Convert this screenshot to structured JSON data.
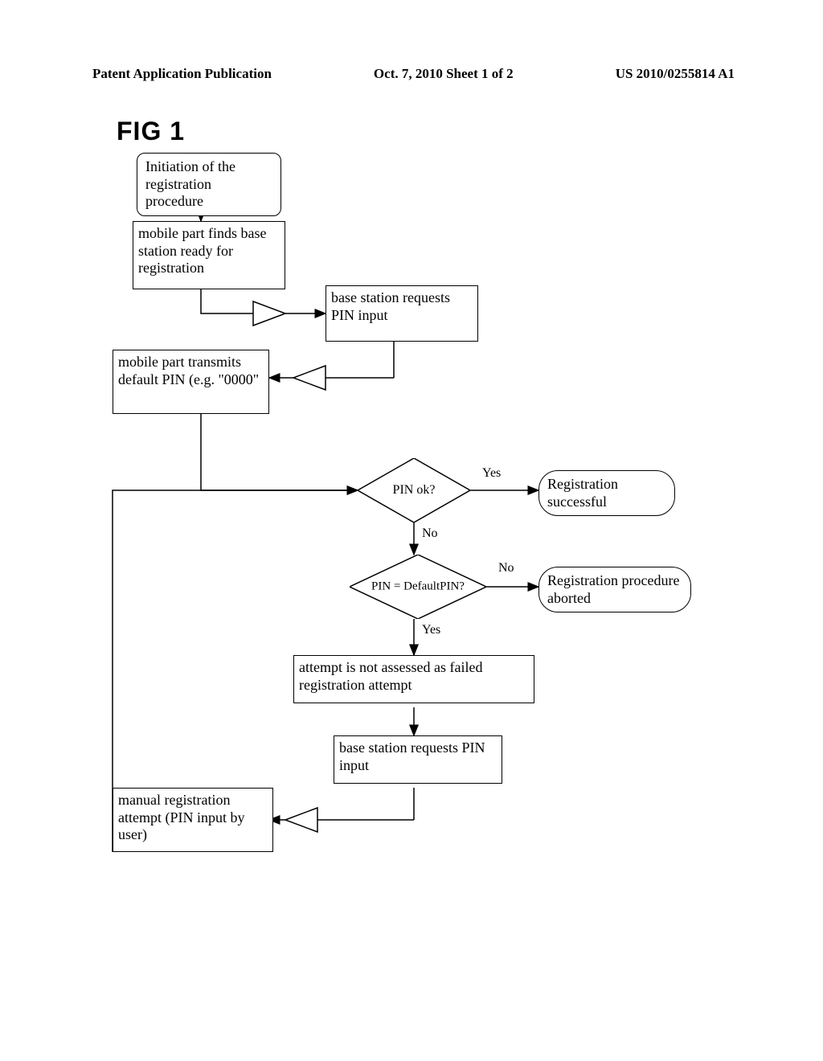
{
  "header": {
    "left": "Patent Application Publication",
    "center": "Oct. 7, 2010  Sheet 1 of 2",
    "right": "US 2010/0255814 A1"
  },
  "figure_label": "FIG 1",
  "nodes": {
    "start": "Initiation of the registration procedure",
    "find": "mobile part finds base station ready for registration",
    "req1": "base station requests PIN input",
    "txdef": "mobile part transmits default PIN (e.g. \"0000\"",
    "pinok": "PIN ok?",
    "success": "Registration successful",
    "pindef": "PIN = DefaultPIN?",
    "aborted": "Registration procedure aborted",
    "notfailed": "attempt is not assessed as failed registration attempt",
    "req2": "base station requests PIN input",
    "manual": "manual registration attempt (PIN input by user)"
  },
  "labels": {
    "yes": "Yes",
    "no": "No"
  }
}
